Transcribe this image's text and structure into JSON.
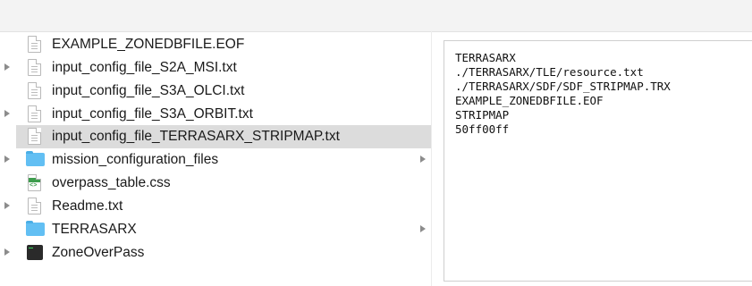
{
  "files": [
    {
      "name": "EXAMPLE_ZONEDBFILE.EOF",
      "kind": "document",
      "expandable": false,
      "selected": false,
      "has_children": false
    },
    {
      "name": "input_config_file_S2A_MSI.txt",
      "kind": "document",
      "expandable": true,
      "selected": false,
      "has_children": false
    },
    {
      "name": "input_config_file_S3A_OLCI.txt",
      "kind": "document",
      "expandable": false,
      "selected": false,
      "has_children": false
    },
    {
      "name": "input_config_file_S3A_ORBIT.txt",
      "kind": "document",
      "expandable": true,
      "selected": false,
      "has_children": false
    },
    {
      "name": "input_config_file_TERRASARX_STRIPMAP.txt",
      "kind": "document",
      "expandable": false,
      "selected": true,
      "has_children": false
    },
    {
      "name": "mission_configuration_files",
      "kind": "folder",
      "expandable": true,
      "selected": false,
      "has_children": true
    },
    {
      "name": "overpass_table.css",
      "kind": "css",
      "expandable": false,
      "selected": false,
      "has_children": false
    },
    {
      "name": "Readme.txt",
      "kind": "document",
      "expandable": true,
      "selected": false,
      "has_children": false
    },
    {
      "name": "TERRASARX",
      "kind": "folder",
      "expandable": false,
      "selected": false,
      "has_children": true
    },
    {
      "name": "ZoneOverPass",
      "kind": "executable",
      "expandable": true,
      "selected": false,
      "has_children": false
    }
  ],
  "preview": {
    "lines": [
      "TERRASARX",
      "./TERRASARX/TLE/resource.txt",
      "./TERRASARX/SDF/SDF_STRIPMAP.TRX",
      "EXAMPLE_ZONEDBFILE.EOF",
      "STRIPMAP",
      "50ff00ff"
    ]
  },
  "colors": {
    "selection": "#dcdcdc",
    "folder": "#62bff3",
    "css_badge": "#3e9d4e"
  }
}
